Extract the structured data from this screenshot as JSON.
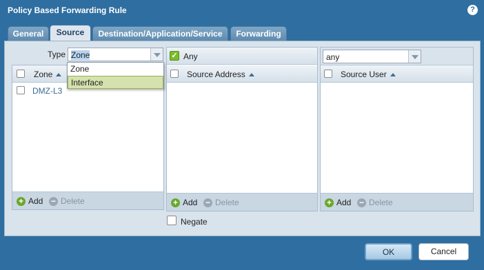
{
  "dialog": {
    "title": "Policy Based Forwarding Rule",
    "help_icon": "?"
  },
  "tabs": [
    {
      "label": "General",
      "active": false
    },
    {
      "label": "Source",
      "active": true
    },
    {
      "label": "Destination/Application/Service",
      "active": false
    },
    {
      "label": "Forwarding",
      "active": false
    }
  ],
  "zone_panel": {
    "type_label": "Type",
    "type_value": "Zone",
    "dropdown_options": [
      "Zone",
      "Interface"
    ],
    "highlighted_option": "Interface",
    "column_header": "Zone",
    "rows": [
      "DMZ-L3"
    ],
    "add_label": "Add",
    "delete_label": "Delete"
  },
  "address_panel": {
    "any_label": "Any",
    "any_checked": true,
    "column_header": "Source Address",
    "add_label": "Add",
    "delete_label": "Delete"
  },
  "user_panel": {
    "select_value": "any",
    "column_header": "Source User",
    "add_label": "Add",
    "delete_label": "Delete"
  },
  "negate": {
    "label": "Negate",
    "checked": false
  },
  "buttons": {
    "ok": "OK",
    "cancel": "Cancel"
  },
  "colors": {
    "dialog_bg": "#2f6ea0",
    "panel_bg": "#d9e3ec",
    "highlight": "#d5e2ad",
    "add_green": "#6aa72b"
  }
}
